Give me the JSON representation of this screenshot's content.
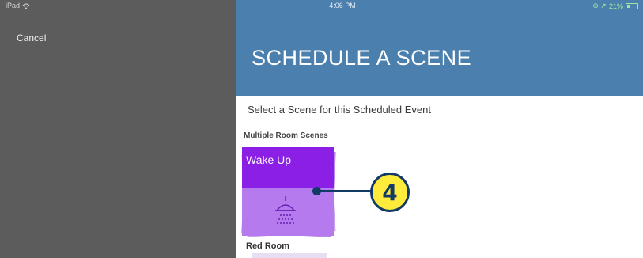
{
  "status_bar": {
    "device": "iPad",
    "time": "4:06 PM",
    "battery": "21%"
  },
  "left": {
    "cancel_label": "Cancel"
  },
  "header": {
    "title": "SCHEDULE A SCENE",
    "color": "#4a7fae"
  },
  "main": {
    "prompt": "Select a Scene for this Scheduled Event",
    "section_label": "Multiple Room Scenes",
    "scene_card": {
      "label": "Wake Up",
      "icon": "shower-icon",
      "top_color": "#8b1fe6",
      "bottom_color": "#b57bee"
    },
    "next_section_label": "Red Room"
  },
  "callout": {
    "number": "4",
    "color": "#ffeb3b"
  }
}
